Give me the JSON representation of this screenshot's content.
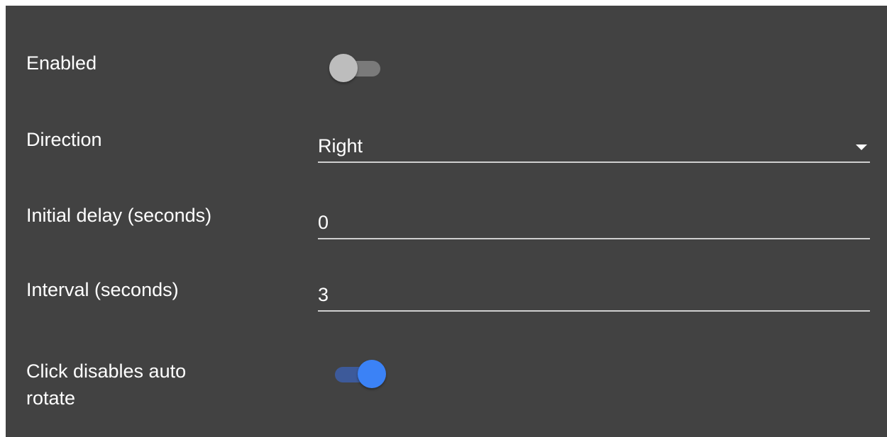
{
  "settings": {
    "enabled": {
      "label": "Enabled",
      "checked": false
    },
    "direction": {
      "label": "Direction",
      "value": "Right"
    },
    "initial_delay": {
      "label": "Initial delay (seconds)",
      "value": "0"
    },
    "interval": {
      "label": "Interval (seconds)",
      "value": "3"
    },
    "click_disables": {
      "label_line1": "Click disables auto",
      "label_line2": "rotate",
      "checked": true
    }
  },
  "colors": {
    "panel_background": "#424242",
    "accent": "#3b82f6"
  },
  "icons": {
    "direction_dropdown": "triangle-down-icon"
  }
}
